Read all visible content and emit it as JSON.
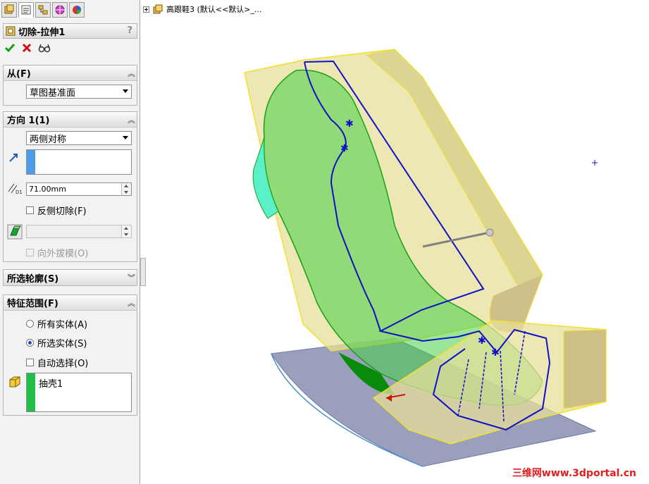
{
  "feature": {
    "title": "切除-拉伸1",
    "help": "?"
  },
  "tabs": [
    "feature-manager-icon",
    "property-manager-icon",
    "configuration-manager-icon",
    "dimxpert-icon",
    "display-manager-icon"
  ],
  "from_group": {
    "header": "从(F)",
    "value": "草图基准面"
  },
  "direction1": {
    "header": "方向 1(1)",
    "end_condition": "两侧对称",
    "depth": "71.00mm",
    "depth_icon_label": "D1",
    "flip_side": "反侧切除(F)",
    "draft_outward": "向外拔模(O)"
  },
  "selected_contours": {
    "header": "所选轮廓(S)"
  },
  "feature_scope": {
    "header": "特征范围(F)",
    "all_bodies": "所有实体(A)",
    "selected_bodies": "所选实体(S)",
    "auto_select": "自动选择(O)",
    "bodies": [
      "抽壳1"
    ]
  },
  "tree": {
    "label": "高跟鞋3  (默认<<默认>_..."
  },
  "watermark": "三维网www.3dportal.cn",
  "colors": {
    "accent_blue": "#4a90e2",
    "green_bar": "#22c04a",
    "sketch_blue": "#1010c8"
  }
}
